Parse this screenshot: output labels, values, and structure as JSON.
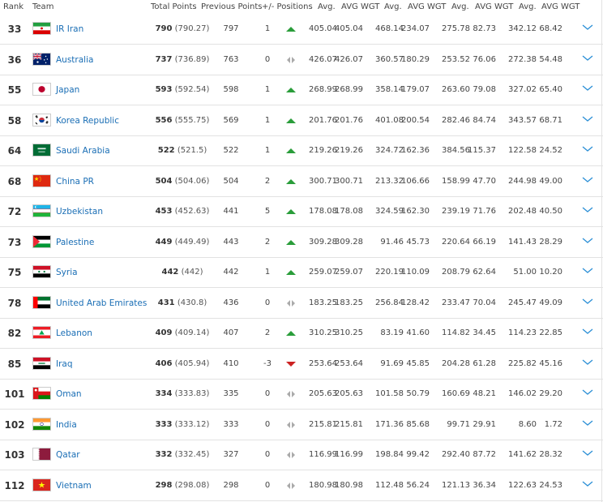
{
  "header": {
    "rank": "Rank",
    "team": "Team",
    "total_points": "Total Points",
    "previous_points": "Previous Points",
    "plus_minus_positions": "+/- Positions",
    "avg1": "Avg.",
    "avg_wgt1": "AVG WGT",
    "avg2": "Avg.",
    "avg_wgt2": "AVG WGT",
    "avg3": "Avg.",
    "avg_wgt3": "AVG WGT",
    "avg4": "Avg.",
    "avg_wgt4": "AVG WGT"
  },
  "rows": [
    {
      "rank": "33",
      "team": "IR Iran",
      "flag": "iran",
      "tp": "790",
      "tp_exact": "(790.27)",
      "pp": "797",
      "diff": "1",
      "move": "up",
      "vals": [
        "405.04",
        "405.04",
        "468.14",
        "234.07",
        "275.78",
        "82.73",
        "342.12",
        "68.42"
      ]
    },
    {
      "rank": "36",
      "team": "Australia",
      "flag": "australia",
      "tp": "737",
      "tp_exact": "(736.89)",
      "pp": "763",
      "diff": "0",
      "move": "none",
      "vals": [
        "426.07",
        "426.07",
        "360.57",
        "180.29",
        "253.52",
        "76.06",
        "272.38",
        "54.48"
      ]
    },
    {
      "rank": "55",
      "team": "Japan",
      "flag": "japan",
      "tp": "593",
      "tp_exact": "(592.54)",
      "pp": "598",
      "diff": "1",
      "move": "up",
      "vals": [
        "268.99",
        "268.99",
        "358.14",
        "179.07",
        "263.60",
        "79.08",
        "327.02",
        "65.40"
      ]
    },
    {
      "rank": "58",
      "team": "Korea Republic",
      "flag": "korea",
      "tp": "556",
      "tp_exact": "(555.75)",
      "pp": "569",
      "diff": "1",
      "move": "up",
      "vals": [
        "201.76",
        "201.76",
        "401.08",
        "200.54",
        "282.46",
        "84.74",
        "343.57",
        "68.71"
      ]
    },
    {
      "rank": "64",
      "team": "Saudi Arabia",
      "flag": "saudi",
      "tp": "522",
      "tp_exact": "(521.5)",
      "pp": "522",
      "diff": "1",
      "move": "up",
      "vals": [
        "219.26",
        "219.26",
        "324.72",
        "162.36",
        "384.56",
        "115.37",
        "122.58",
        "24.52"
      ]
    },
    {
      "rank": "68",
      "team": "China PR",
      "flag": "china",
      "tp": "504",
      "tp_exact": "(504.06)",
      "pp": "504",
      "diff": "2",
      "move": "up",
      "vals": [
        "300.71",
        "300.71",
        "213.32",
        "106.66",
        "158.99",
        "47.70",
        "244.98",
        "49.00"
      ]
    },
    {
      "rank": "72",
      "team": "Uzbekistan",
      "flag": "uzbekistan",
      "tp": "453",
      "tp_exact": "(452.63)",
      "pp": "441",
      "diff": "5",
      "move": "up",
      "vals": [
        "178.08",
        "178.08",
        "324.59",
        "162.30",
        "239.19",
        "71.76",
        "202.48",
        "40.50"
      ]
    },
    {
      "rank": "73",
      "team": "Palestine",
      "flag": "palestine",
      "tp": "449",
      "tp_exact": "(449.49)",
      "pp": "443",
      "diff": "2",
      "move": "up",
      "vals": [
        "309.28",
        "309.28",
        "91.46",
        "45.73",
        "220.64",
        "66.19",
        "141.43",
        "28.29"
      ]
    },
    {
      "rank": "75",
      "team": "Syria",
      "flag": "syria",
      "tp": "442",
      "tp_exact": "(442)",
      "pp": "442",
      "diff": "1",
      "move": "up",
      "vals": [
        "259.07",
        "259.07",
        "220.19",
        "110.09",
        "208.79",
        "62.64",
        "51.00",
        "10.20"
      ]
    },
    {
      "rank": "78",
      "team": "United Arab Emirates",
      "flag": "uae",
      "tp": "431",
      "tp_exact": "(430.8)",
      "pp": "436",
      "diff": "0",
      "move": "none",
      "vals": [
        "183.25",
        "183.25",
        "256.84",
        "128.42",
        "233.47",
        "70.04",
        "245.47",
        "49.09"
      ]
    },
    {
      "rank": "82",
      "team": "Lebanon",
      "flag": "lebanon",
      "tp": "409",
      "tp_exact": "(409.14)",
      "pp": "407",
      "diff": "2",
      "move": "up",
      "vals": [
        "310.25",
        "310.25",
        "83.19",
        "41.60",
        "114.82",
        "34.45",
        "114.23",
        "22.85"
      ]
    },
    {
      "rank": "85",
      "team": "Iraq",
      "flag": "iraq",
      "tp": "406",
      "tp_exact": "(405.94)",
      "pp": "410",
      "diff": "-3",
      "move": "down",
      "vals": [
        "253.64",
        "253.64",
        "91.69",
        "45.85",
        "204.28",
        "61.28",
        "225.82",
        "45.16"
      ]
    },
    {
      "rank": "101",
      "team": "Oman",
      "flag": "oman",
      "tp": "334",
      "tp_exact": "(333.83)",
      "pp": "335",
      "diff": "0",
      "move": "none",
      "vals": [
        "205.63",
        "205.63",
        "101.58",
        "50.79",
        "160.69",
        "48.21",
        "146.02",
        "29.20"
      ]
    },
    {
      "rank": "102",
      "team": "India",
      "flag": "india",
      "tp": "333",
      "tp_exact": "(333.12)",
      "pp": "333",
      "diff": "0",
      "move": "none",
      "vals": [
        "215.81",
        "215.81",
        "171.36",
        "85.68",
        "99.71",
        "29.91",
        "8.60",
        "1.72"
      ]
    },
    {
      "rank": "103",
      "team": "Qatar",
      "flag": "qatar",
      "tp": "332",
      "tp_exact": "(332.45)",
      "pp": "327",
      "diff": "0",
      "move": "none",
      "vals": [
        "116.99",
        "116.99",
        "198.84",
        "99.42",
        "292.40",
        "87.72",
        "141.62",
        "28.32"
      ]
    },
    {
      "rank": "112",
      "team": "Vietnam",
      "flag": "vietnam",
      "tp": "298",
      "tp_exact": "(298.08)",
      "pp": "298",
      "diff": "0",
      "move": "none",
      "vals": [
        "180.98",
        "180.98",
        "112.48",
        "56.24",
        "121.13",
        "36.34",
        "122.63",
        "24.53"
      ]
    }
  ],
  "colors": {
    "team_link": "#1a6eb5",
    "up": "#2a9d3a",
    "down": "#cc2222",
    "none": "#aaaaaa",
    "chevron": "#2b8fd6",
    "border": "#e2e2e2"
  }
}
